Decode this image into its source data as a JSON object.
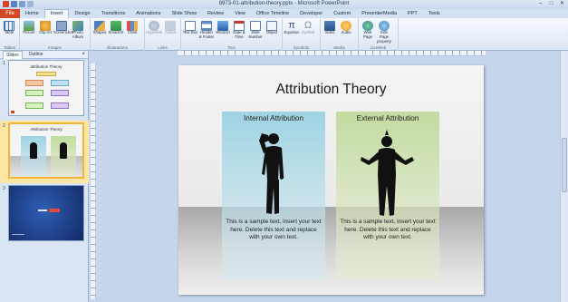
{
  "window": {
    "title": "8973-01-attribution-theory.pptx - Microsoft PowerPoint",
    "minimize": "–",
    "maximize": "□",
    "close": "✕"
  },
  "tabs": [
    "Home",
    "Insert",
    "Design",
    "Transitions",
    "Animations",
    "Slide Show",
    "Review",
    "View",
    "Office Timeline",
    "Developer",
    "Custom",
    "PresenterMedia",
    "PPT",
    "Tools"
  ],
  "file_tab": "File",
  "active_tab": "Insert",
  "ribbon": {
    "groups": [
      {
        "label": "Tables",
        "buttons": [
          "Table"
        ]
      },
      {
        "label": "Images",
        "buttons": [
          "Picture",
          "Clip Art",
          "Screenshot",
          "Photo Album"
        ]
      },
      {
        "label": "Illustrations",
        "buttons": [
          "Shapes",
          "SmartArt",
          "Chart"
        ]
      },
      {
        "label": "Links",
        "buttons": [
          "Hyperlink",
          "Action"
        ]
      },
      {
        "label": "Text",
        "buttons": [
          "Text Box",
          "Header & Footer",
          "WordArt",
          "Date & Time",
          "Slide Number",
          "Object"
        ]
      },
      {
        "label": "Symbols",
        "buttons": [
          "Equation",
          "Symbol"
        ]
      },
      {
        "label": "Media",
        "buttons": [
          "Video",
          "Audio"
        ]
      },
      {
        "label": "LiveWeb",
        "buttons": [
          "Web Page",
          "Edit Page property"
        ]
      }
    ]
  },
  "left_pane": {
    "tabs": [
      "Slides",
      "Outline"
    ],
    "close": "×",
    "slide_numbers": [
      "1",
      "2",
      "3"
    ],
    "thumb1_title": "attribution Theory",
    "thumb2_title": "Attribution Theory"
  },
  "slide": {
    "title": "Attribution Theory",
    "left_heading": "Internal Attribution",
    "right_heading": "External Attribution",
    "left_text": "This is a sample text, insert your text here. Delete this text and replace with your own text.",
    "right_text": "This is a sample text, insert your text here. Delete this text and replace with your own text."
  },
  "colors": {
    "file_tab": "#d24726",
    "internal_panel": "#9fd3e2",
    "external_panel": "#c3dba0",
    "selected_thumb_border": "#f2b53a",
    "thumb3_bg": "#1f3d8f"
  }
}
